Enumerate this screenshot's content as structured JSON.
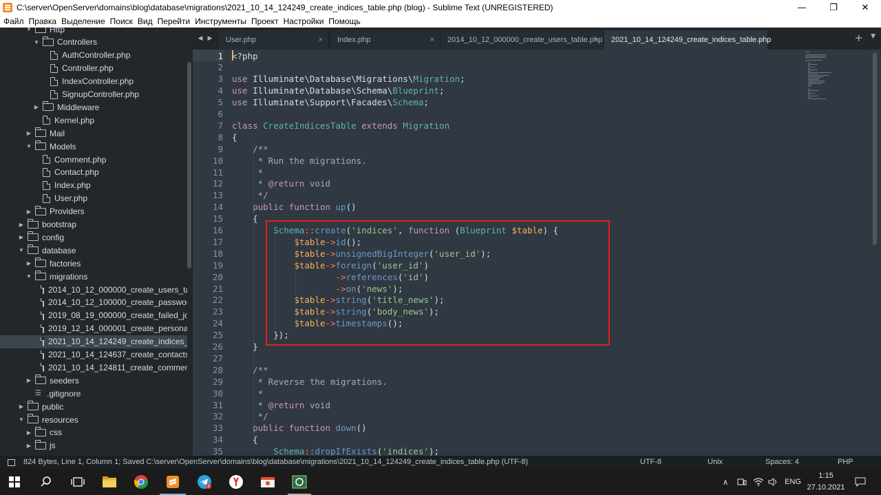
{
  "window": {
    "title": "C:\\server\\OpenServer\\domains\\blog\\database\\migrations\\2021_10_14_124249_create_indices_table.php (blog) - Sublime Text (UNREGISTERED)",
    "minimize": "—",
    "maximize": "❐",
    "close": "✕"
  },
  "menu": [
    "Файл",
    "Правка",
    "Выделение",
    "Поиск",
    "Вид",
    "Перейти",
    "Инструменты",
    "Проект",
    "Настройки",
    "Помощь"
  ],
  "sidebar": {
    "items": [
      {
        "label": "Http",
        "kind": "folder",
        "open": true,
        "depth": 1
      },
      {
        "label": "Controllers",
        "kind": "folder",
        "open": true,
        "depth": 2
      },
      {
        "label": "AuthController.php",
        "kind": "file",
        "depth": 3
      },
      {
        "label": "Controller.php",
        "kind": "file",
        "depth": 3
      },
      {
        "label": "IndexController.php",
        "kind": "file",
        "depth": 3
      },
      {
        "label": "SignupController.php",
        "kind": "file",
        "depth": 3
      },
      {
        "label": "Middleware",
        "kind": "folder",
        "open": false,
        "depth": 2
      },
      {
        "label": "Kernel.php",
        "kind": "file",
        "depth": 2
      },
      {
        "label": "Mail",
        "kind": "folder",
        "open": false,
        "depth": 1
      },
      {
        "label": "Models",
        "kind": "folder",
        "open": true,
        "depth": 1
      },
      {
        "label": "Comment.php",
        "kind": "file",
        "depth": 2
      },
      {
        "label": "Contact.php",
        "kind": "file",
        "depth": 2
      },
      {
        "label": "Index.php",
        "kind": "file",
        "depth": 2
      },
      {
        "label": "User.php",
        "kind": "file",
        "depth": 2
      },
      {
        "label": "Providers",
        "kind": "folder",
        "open": false,
        "depth": 1
      },
      {
        "label": "bootstrap",
        "kind": "folder",
        "open": false,
        "depth": 0
      },
      {
        "label": "config",
        "kind": "folder",
        "open": false,
        "depth": 0
      },
      {
        "label": "database",
        "kind": "folder",
        "open": true,
        "depth": 0
      },
      {
        "label": "factories",
        "kind": "folder",
        "open": false,
        "depth": 1
      },
      {
        "label": "migrations",
        "kind": "folder",
        "open": true,
        "depth": 1
      },
      {
        "label": "2014_10_12_000000_create_users_tab",
        "kind": "file",
        "depth": 2
      },
      {
        "label": "2014_10_12_100000_create_password",
        "kind": "file",
        "depth": 2
      },
      {
        "label": "2019_08_19_000000_create_failed_job",
        "kind": "file",
        "depth": 2
      },
      {
        "label": "2019_12_14_000001_create_personal_",
        "kind": "file",
        "depth": 2
      },
      {
        "label": "2021_10_14_124249_create_indices_ta",
        "kind": "file",
        "depth": 2,
        "selected": true
      },
      {
        "label": "2021_10_14_124637_create_contacts_",
        "kind": "file",
        "depth": 2
      },
      {
        "label": "2021_10_14_124811_create_comment",
        "kind": "file",
        "depth": 2
      },
      {
        "label": "seeders",
        "kind": "folder",
        "open": false,
        "depth": 1
      },
      {
        "label": ".gitignore",
        "kind": "lines",
        "depth": 1
      },
      {
        "label": "public",
        "kind": "folder",
        "open": false,
        "depth": 0
      },
      {
        "label": "resources",
        "kind": "folder",
        "open": true,
        "depth": 0
      },
      {
        "label": "css",
        "kind": "folder",
        "open": false,
        "depth": 1
      },
      {
        "label": "js",
        "kind": "folder",
        "open": false,
        "depth": 1
      }
    ]
  },
  "tabs": [
    {
      "label": "User.php",
      "active": false
    },
    {
      "label": "Index.php",
      "active": false
    },
    {
      "label": "2014_10_12_000000_create_users_table.php",
      "active": false
    },
    {
      "label": "2021_10_14_124249_create_indices_table.php",
      "active": true
    }
  ],
  "tab_close": "×",
  "tab_add": "+",
  "editor": {
    "current_line": 1,
    "lines": [
      [
        [
          "pl",
          "<?php"
        ]
      ],
      [],
      [
        [
          "kw",
          "use "
        ],
        [
          "pl",
          "Illuminate\\Database\\Migrations\\"
        ],
        [
          "cls",
          "Migration"
        ],
        [
          "pl",
          ";"
        ]
      ],
      [
        [
          "kw",
          "use "
        ],
        [
          "pl",
          "Illuminate\\Database\\Schema\\"
        ],
        [
          "cls",
          "Blueprint"
        ],
        [
          "pl",
          ";"
        ]
      ],
      [
        [
          "kw",
          "use "
        ],
        [
          "pl",
          "Illuminate\\Support\\Facades\\"
        ],
        [
          "cls",
          "Schema"
        ],
        [
          "pl",
          ";"
        ]
      ],
      [],
      [
        [
          "kw",
          "class "
        ],
        [
          "cls",
          "CreateIndicesTable "
        ],
        [
          "kw",
          "extends "
        ],
        [
          "cls",
          "Migration"
        ]
      ],
      [
        [
          "pl",
          "{"
        ]
      ],
      [
        [
          "cm",
          "    /**"
        ]
      ],
      [
        [
          "cm",
          "     * Run the migrations."
        ]
      ],
      [
        [
          "cm",
          "     *"
        ]
      ],
      [
        [
          "cm",
          "     * "
        ],
        [
          "kw",
          "@return "
        ],
        [
          "cm",
          "void"
        ]
      ],
      [
        [
          "cm",
          "     */"
        ]
      ],
      [
        [
          "kw",
          "    public function "
        ],
        [
          "fn",
          "up"
        ],
        [
          "pl",
          "()"
        ]
      ],
      [
        [
          "pl",
          "    {"
        ]
      ],
      [
        [
          "pl",
          "        "
        ],
        [
          "cls",
          "Schema"
        ],
        [
          "op",
          "::"
        ],
        [
          "fn",
          "create"
        ],
        [
          "pl",
          "("
        ],
        [
          "str",
          "'indices'"
        ],
        [
          "pl",
          ", "
        ],
        [
          "kw",
          "function "
        ],
        [
          "pl",
          "("
        ],
        [
          "cls",
          "Blueprint "
        ],
        [
          "ag",
          "$table"
        ],
        [
          "pl",
          ") {"
        ]
      ],
      [
        [
          "pl",
          "            "
        ],
        [
          "var",
          "$table"
        ],
        [
          "op",
          "->"
        ],
        [
          "fn",
          "id"
        ],
        [
          "pl",
          "();"
        ]
      ],
      [
        [
          "pl",
          "            "
        ],
        [
          "var",
          "$table"
        ],
        [
          "op",
          "->"
        ],
        [
          "fn",
          "unsignedBigInteger"
        ],
        [
          "pl",
          "("
        ],
        [
          "str",
          "'user_id'"
        ],
        [
          "pl",
          ");"
        ]
      ],
      [
        [
          "pl",
          "            "
        ],
        [
          "var",
          "$table"
        ],
        [
          "op",
          "->"
        ],
        [
          "fn",
          "foreign"
        ],
        [
          "pl",
          "("
        ],
        [
          "str",
          "'user_id'"
        ],
        [
          "pl",
          ")"
        ]
      ],
      [
        [
          "pl",
          "                    "
        ],
        [
          "op",
          "->"
        ],
        [
          "fn",
          "references"
        ],
        [
          "pl",
          "("
        ],
        [
          "str",
          "'id'"
        ],
        [
          "pl",
          ")"
        ]
      ],
      [
        [
          "pl",
          "                    "
        ],
        [
          "op",
          "->"
        ],
        [
          "fn",
          "on"
        ],
        [
          "pl",
          "("
        ],
        [
          "str",
          "'news'"
        ],
        [
          "pl",
          ");"
        ]
      ],
      [
        [
          "pl",
          "            "
        ],
        [
          "var",
          "$table"
        ],
        [
          "op",
          "->"
        ],
        [
          "fn",
          "string"
        ],
        [
          "pl",
          "("
        ],
        [
          "str",
          "'title_news'"
        ],
        [
          "pl",
          ");"
        ]
      ],
      [
        [
          "pl",
          "            "
        ],
        [
          "var",
          "$table"
        ],
        [
          "op",
          "->"
        ],
        [
          "fn",
          "string"
        ],
        [
          "pl",
          "("
        ],
        [
          "str",
          "'body_news'"
        ],
        [
          "pl",
          ");"
        ]
      ],
      [
        [
          "pl",
          "            "
        ],
        [
          "var",
          "$table"
        ],
        [
          "op",
          "->"
        ],
        [
          "fn",
          "timestamps"
        ],
        [
          "pl",
          "();"
        ]
      ],
      [
        [
          "pl",
          "        });"
        ]
      ],
      [
        [
          "pl",
          "    }"
        ]
      ],
      [],
      [
        [
          "cm",
          "    /**"
        ]
      ],
      [
        [
          "cm",
          "     * Reverse the migrations."
        ]
      ],
      [
        [
          "cm",
          "     *"
        ]
      ],
      [
        [
          "cm",
          "     * "
        ],
        [
          "kw",
          "@return "
        ],
        [
          "cm",
          "void"
        ]
      ],
      [
        [
          "cm",
          "     */"
        ]
      ],
      [
        [
          "kw",
          "    public function "
        ],
        [
          "fn",
          "down"
        ],
        [
          "pl",
          "()"
        ]
      ],
      [
        [
          "pl",
          "    {"
        ]
      ],
      [
        [
          "pl",
          "        "
        ],
        [
          "cls",
          "Schema"
        ],
        [
          "op",
          "::"
        ],
        [
          "fn",
          "dropIfExists"
        ],
        [
          "pl",
          "("
        ],
        [
          "str",
          "'indices'"
        ],
        [
          "pl",
          ");"
        ]
      ]
    ]
  },
  "status": {
    "message": "824 Bytes, Line 1, Column 1; Saved C:\\server\\OpenServer\\domains\\blog\\database\\migrations\\2021_10_14_124249_create_indices_table.php (UTF-8)",
    "encoding": "UTF-8",
    "line_endings": "Unix",
    "indent": "Spaces: 4",
    "syntax": "PHP"
  },
  "taskbar": {
    "badge_count": "3",
    "lang": "ENG",
    "time": "1:15",
    "date": "27.10.2021",
    "tray_up": "∧"
  },
  "colors": {
    "accent_red": "#e02020",
    "editor_bg": "#303841",
    "sidebar_bg": "#21272b"
  }
}
